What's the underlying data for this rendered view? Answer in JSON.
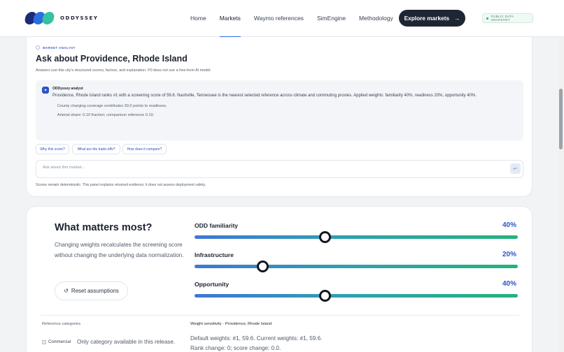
{
  "header": {
    "brand": "ODDYSSEY",
    "nav": [
      "Home",
      "Markets",
      "Waymo references",
      "SimEngine",
      "Methodology"
    ],
    "active_nav": "Markets",
    "cta_label": "Explore markets",
    "cta_icon": "arrow-right-icon",
    "badge_label": "PUBLIC DATA SNAPSHOT"
  },
  "analyst": {
    "eyebrow": "MARKET ANALYST",
    "title": "Ask about Providence, Rhode Island",
    "subtitle": "Answers use this city's structured scores, factors, and explanation. P0 does not use a free-form AI model.",
    "answer_name": "ODDyssey analyst",
    "answer_text": "Providence, Rhode Island ranks #1 with a screening score of 59.6. Nashville, Tennessee is the nearest selected reference across climate and commuting proxies. Applied weights: familiarity 40%, readiness 20%, opportunity 40%.",
    "bullets": [
      "County charging coverage contributes 30.0 points to readiness.",
      "Arterial share: 0.10 fraction; comparison reference 0.10."
    ],
    "suggestions": [
      "Why this score?",
      "What are the trade-offs?",
      "How does it compare?"
    ],
    "input_placeholder": "Ask about this market...",
    "input_value": "",
    "disclaimer": "Scores remain deterministic. This panel explains returned evidence; it does not assess deployment safety."
  },
  "weights": {
    "title": "What matters most?",
    "description": "Changing weights recalculates the screening score without changing the underlying data normalization.",
    "reset_label": "Reset assumptions",
    "sliders": [
      {
        "label": "ODD familiarity",
        "value_text": "40%",
        "value": 0.4
      },
      {
        "label": "Infrastructure",
        "value_text": "20%",
        "value": 0.2
      },
      {
        "label": "Opportunity",
        "value_text": "40%",
        "value": 0.4
      }
    ],
    "ref_categories_label": "Reference categories",
    "category": {
      "name": "Commercial",
      "note": "Only category available in this release.",
      "checked": true
    },
    "sensitivity_label": "Weight sensitivity · Providence, Rhode Island",
    "sensitivity_lines": [
      "Default weights: #1, 59.6. Current weights: #1, 59.6.",
      "Rank change: 0; score change: 0.0."
    ]
  },
  "colors": {
    "accent": "#2a55c9",
    "dark": "#1e2533",
    "success": "#23b07a"
  }
}
